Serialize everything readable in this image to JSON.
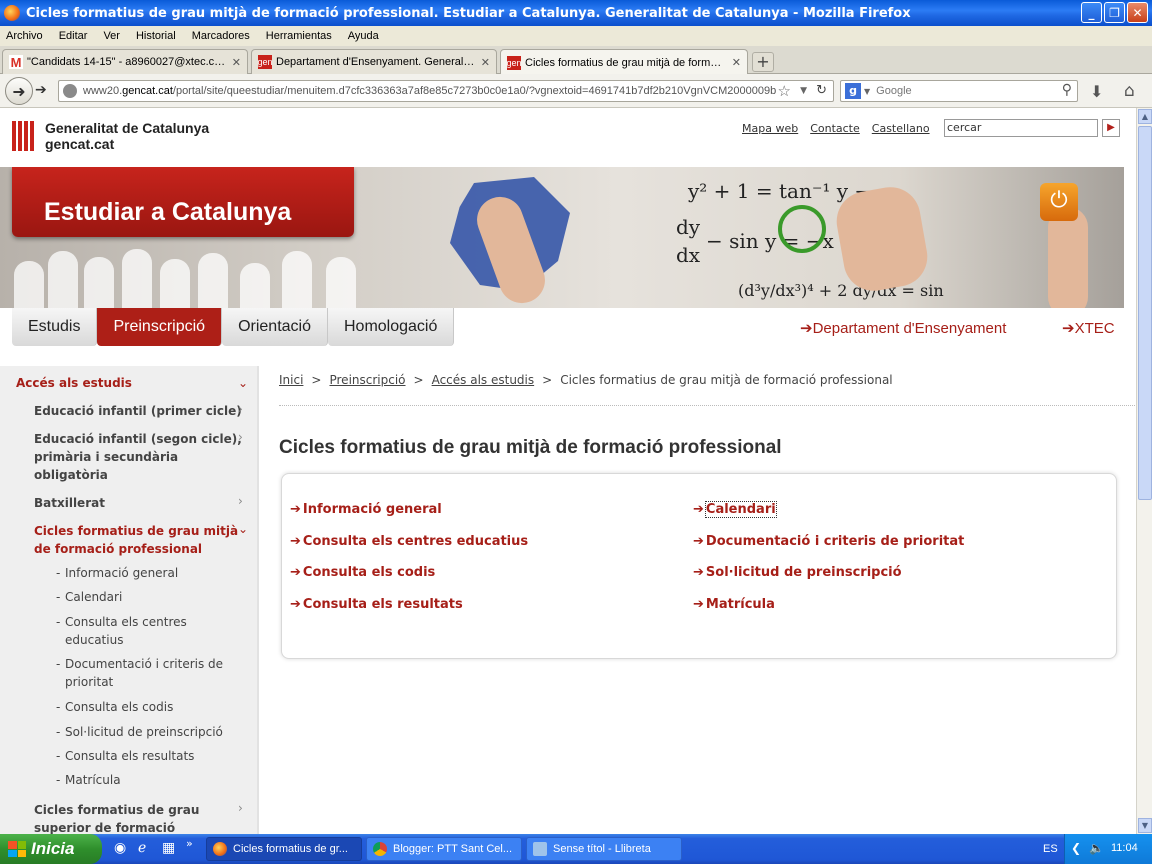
{
  "window": {
    "title": "Cicles formatius de grau mitjà de formació professional. Estudiar a Catalunya. Generalitat de Catalunya - Mozilla Firefox",
    "buttons": {
      "minimize": "_",
      "maximize": "❐",
      "close": "✕"
    }
  },
  "menubar": [
    "Archivo",
    "Editar",
    "Ver",
    "Historial",
    "Marcadores",
    "Herramientas",
    "Ayuda"
  ],
  "tabs": [
    {
      "label": "\"Candidats 14-15\" - a8960027@xtec.cat ...",
      "icon": "gmail-icon",
      "active": false
    },
    {
      "label": "Departament d'Ensenyament. Generalita...",
      "icon": "gencat-icon",
      "active": false
    },
    {
      "label": "Cicles formatius de grau mitjà de formaci...",
      "icon": "gencat-icon",
      "active": true
    }
  ],
  "tab_close": "✕",
  "new_tab": "+",
  "navbar": {
    "url_prefix": "www20.",
    "url_domain": "gencat.cat",
    "url_rest": "/portal/site/queestudiar/menuitem.d7cfc336363a7af8e85c7273b0c0e1a0/?vgnextoid=4691741b7df2b210VgnVCM2000009b",
    "search_placeholder": "Google"
  },
  "site": {
    "logo_line1": "Generalitat de Catalunya",
    "logo_line2": "gencat.cat",
    "toplinks": [
      "Mapa web",
      "Contacte",
      "Castellano"
    ],
    "search_value": "cercar",
    "banner_title": "Estudiar a Catalunya",
    "math": {
      "eq1": "y² + 1 = tan⁻¹ y −",
      "eq2a": "dy",
      "eq2b": "dx",
      "eq2c": "− sin y = −x",
      "eq3": "(d³y/dx³)⁴ + 2 dy/dx = sin"
    }
  },
  "mainnav": {
    "tabs": [
      {
        "label": "Estudis",
        "active": false
      },
      {
        "label": "Preinscripció",
        "active": true
      },
      {
        "label": "Orientació",
        "active": false
      },
      {
        "label": "Homologació",
        "active": false
      }
    ],
    "external": [
      "Departament d'Ensenyament",
      "XTEC"
    ]
  },
  "sidebar": {
    "heading": "Accés als estudis",
    "items": [
      "Educació infantil (primer cicle)",
      "Educació infantil (segon cicle), primària i secundària obligatòria",
      "Batxillerat",
      "Cicles formatius de grau mitjà de formació professional",
      "Cicles formatius de grau superior de formació"
    ],
    "subitems": [
      "Informació general",
      "Calendari",
      "Consulta els centres educatius",
      "Documentació i criteris de prioritat",
      "Consulta els codis",
      "Sol·licitud de preinscripció",
      "Consulta els resultats",
      "Matrícula"
    ]
  },
  "breadcrumb": {
    "links": [
      "Inici",
      "Preinscripció",
      "Accés als estudis"
    ],
    "current": "Cicles formatius de grau mitjà de formació professional",
    "sep": ">"
  },
  "page_title": "Cicles formatius de grau mitjà de formació professional",
  "links_left": [
    "Informació general",
    "Consulta els centres educatius",
    "Consulta els codis",
    "Consulta els resultats"
  ],
  "links_right": [
    "Calendari",
    "Documentació i criteris de prioritat",
    "Sol·licitud de preinscripció",
    "Matrícula"
  ],
  "taskbar": {
    "start": "Inicia",
    "tasks": [
      {
        "label": "Cicles formatius de gr...",
        "active": true
      },
      {
        "label": "Blogger: PTT Sant Cel...",
        "active": false
      },
      {
        "label": "Sense títol - Llibreta",
        "active": false
      }
    ],
    "lang": "ES",
    "clock": "11:04"
  },
  "colors": {
    "gencat_red": "#A61F18",
    "xp_blue": "#245EDB",
    "start_green": "#2F8F2C"
  }
}
